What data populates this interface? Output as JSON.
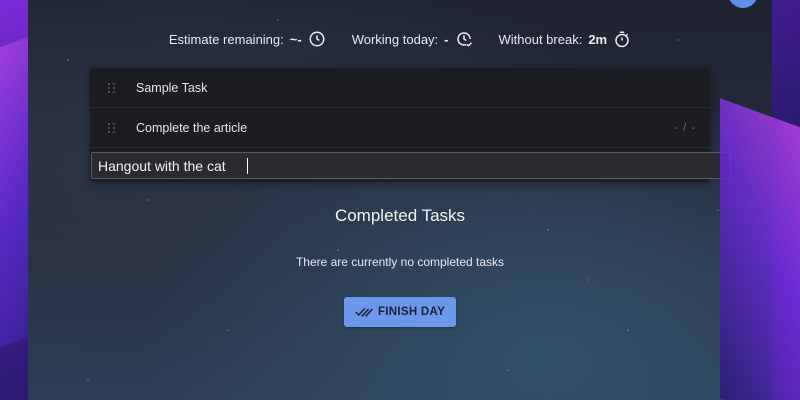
{
  "stats": {
    "estimate_label": "Estimate remaining:",
    "estimate_value": "~-",
    "working_label": "Working today:",
    "working_value": "-",
    "break_label": "Without break:",
    "break_value": "2m"
  },
  "tasks": [
    {
      "title": "Sample Task",
      "meta": ""
    },
    {
      "title": "Complete the article",
      "meta": "- / -"
    },
    {
      "title": "",
      "meta": ""
    }
  ],
  "add_task": {
    "value": "Hangout with the cat"
  },
  "completed": {
    "title": "Completed Tasks",
    "empty_message": "There are currently no completed tasks"
  },
  "finish_button": {
    "label": "FINISH DAY"
  },
  "colors": {
    "accent": "#6b98ea",
    "avatar": "#5f8fea"
  },
  "icons": {
    "estimate": "clock-icon",
    "working": "clock-check-icon",
    "break": "stopwatch-icon",
    "finish": "double-check-icon",
    "drag": "drag-handle-icon"
  }
}
